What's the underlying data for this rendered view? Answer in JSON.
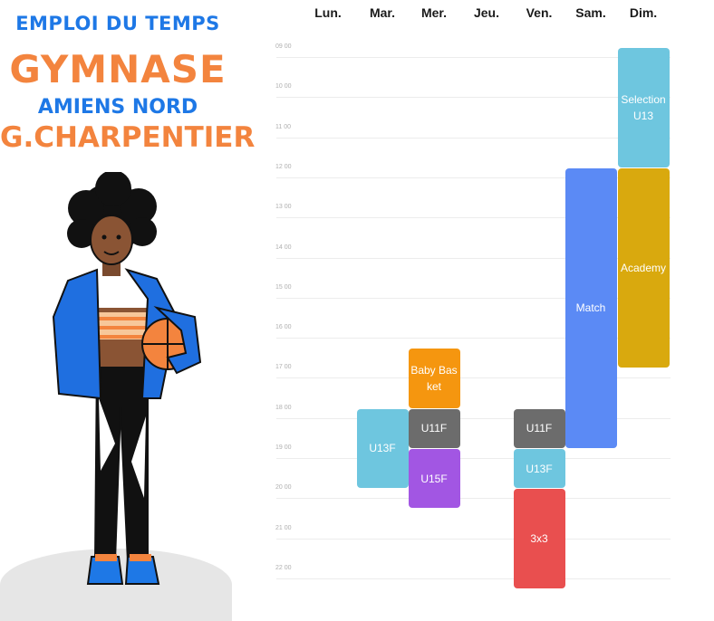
{
  "header": {
    "line1": "EMPLOI DU TEMPS",
    "line2": "GYMNASE",
    "line3": "AMIENS NORD",
    "line4": "G.CHARPENTIER"
  },
  "days": [
    "Lun.",
    "Mar.",
    "Mer.",
    "Jeu.",
    "Ven.",
    "Sam.",
    "Dim."
  ],
  "hours": [
    "09 00",
    "10 00",
    "11 00",
    "12 00",
    "13 00",
    "14 00",
    "15 00",
    "16 00",
    "17 00",
    "18 00",
    "19 00",
    "20 00",
    "21 00",
    "22 00"
  ],
  "events": [
    {
      "label": "U13F",
      "day": "Mar.",
      "start": "18:00",
      "end": "20:00",
      "color": "#6ec6df"
    },
    {
      "label": "Baby Basket",
      "day": "Mer.",
      "start": "16:30",
      "end": "18:00",
      "color": "#f5960f"
    },
    {
      "label": "U11F",
      "day": "Mer.",
      "start": "18:00",
      "end": "19:00",
      "color": "#6c6c6c"
    },
    {
      "label": "U15F",
      "day": "Mer.",
      "start": "19:00",
      "end": "20:30",
      "color": "#a256e3"
    },
    {
      "label": "U11F",
      "day": "Ven.",
      "start": "18:00",
      "end": "19:00",
      "color": "#6c6c6c"
    },
    {
      "label": "U13F",
      "day": "Ven.",
      "start": "19:00",
      "end": "20:00",
      "color": "#6ec6df"
    },
    {
      "label": "3x3",
      "day": "Ven.",
      "start": "20:00",
      "end": "22:30",
      "color": "#e94f4f"
    },
    {
      "label": "Match",
      "day": "Sam.",
      "start": "12:00",
      "end": "19:00",
      "color": "#5b8af5"
    },
    {
      "label": "Selection U13",
      "day": "Dim.",
      "start": "09:00",
      "end": "12:00",
      "color": "#6ec6df"
    },
    {
      "label": "Academy",
      "day": "Dim.",
      "start": "12:00",
      "end": "17:00",
      "color": "#d9a90e"
    }
  ]
}
